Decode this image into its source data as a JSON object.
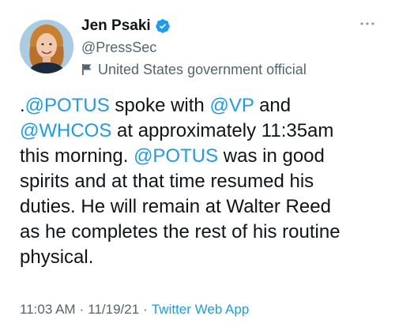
{
  "user": {
    "display_name": "Jen Psaki",
    "handle": "@PressSec",
    "label": "United States government official",
    "verified": true
  },
  "icons": {
    "avatar": "avatar-photo",
    "verified": "verified-badge-icon",
    "label": "flag-icon",
    "more": "more-options-icon"
  },
  "tweet": {
    "parts": [
      {
        "text": ".",
        "mention": false
      },
      {
        "text": "@POTUS",
        "mention": true
      },
      {
        "text": " spoke with ",
        "mention": false
      },
      {
        "text": "@VP",
        "mention": true
      },
      {
        "text": " and\n",
        "mention": false
      },
      {
        "text": "@WHCOS",
        "mention": true
      },
      {
        "text": " at approximately 11:35am\nthis morning. ",
        "mention": false
      },
      {
        "text": "@POTUS",
        "mention": true
      },
      {
        "text": " was in good\nspirits and at that time resumed his\nduties. He will remain at Walter Reed\nas he completes the rest of his routine\nphysical.",
        "mention": false
      }
    ]
  },
  "meta": {
    "time": "11:03 AM",
    "date": "11/19/21",
    "separator": "·",
    "source": "Twitter Web App"
  },
  "colors": {
    "link": "#1d9bf0",
    "secondary_text": "#536471",
    "primary_text": "#0f1419"
  }
}
